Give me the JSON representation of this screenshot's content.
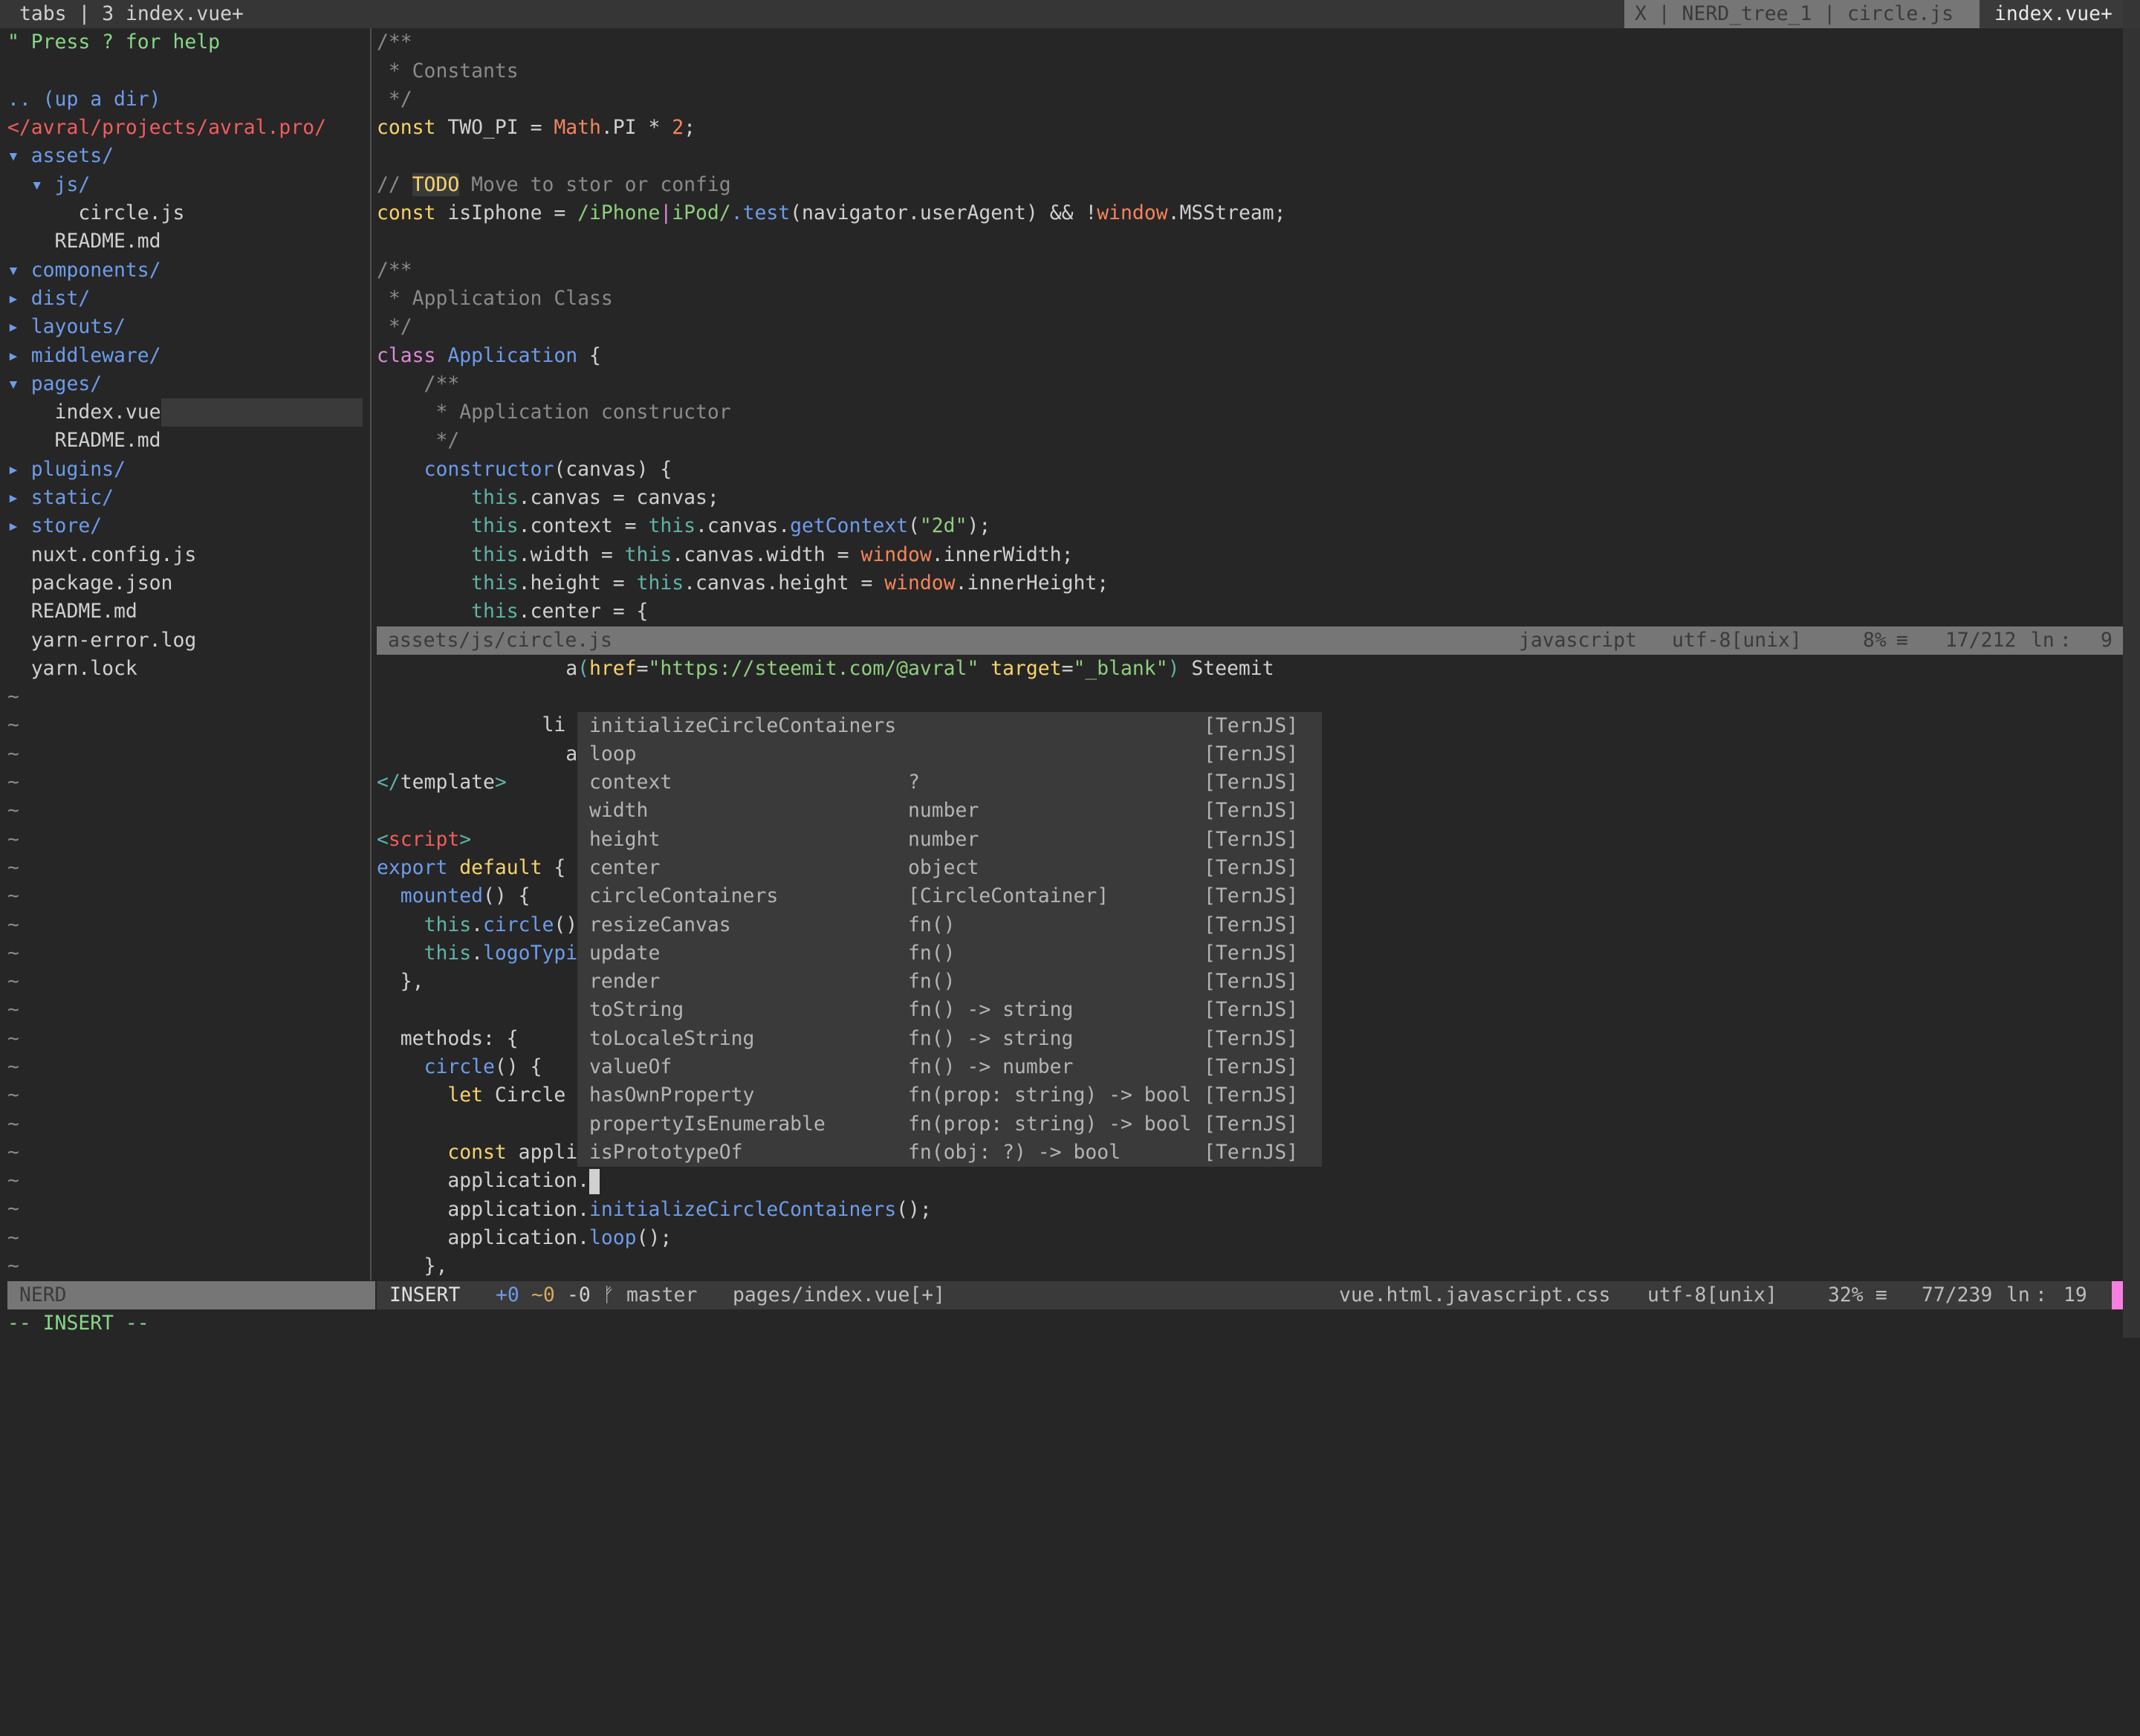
{
  "tabline": {
    "left": "tabs | 3 index.vue+",
    "inactive": "X | NERD_tree_1 | circle.js",
    "active": "index.vue+"
  },
  "nerdtree": {
    "lines": [
      [
        [
          "help",
          "\" Press ? for help"
        ]
      ],
      [],
      [
        [
          "d",
          ".. (up a dir)"
        ]
      ],
      [
        [
          "root",
          "</avral/projects/avral.pro/"
        ]
      ],
      [
        [
          "d",
          "▾ assets/"
        ]
      ],
      [
        [
          "d",
          "  ▾ js/"
        ]
      ],
      [
        [
          "f",
          "      circle.js"
        ]
      ],
      [
        [
          "f",
          "    README.md"
        ]
      ],
      [
        [
          "d",
          "▾ components/"
        ]
      ],
      [
        [
          "d",
          "▸ dist/"
        ]
      ],
      [
        [
          "d",
          "▸ layouts/"
        ]
      ],
      [
        [
          "d",
          "▸ middleware/"
        ]
      ],
      [
        [
          "d",
          "▾ pages/"
        ]
      ],
      [
        [
          "f",
          "    index.vue"
        ],
        [
          "cursorline",
          ""
        ]
      ],
      [
        [
          "f",
          "    README.md"
        ]
      ],
      [
        [
          "d",
          "▸ plugins/"
        ]
      ],
      [
        [
          "d",
          "▸ static/"
        ]
      ],
      [
        [
          "d",
          "▸ store/"
        ]
      ],
      [
        [
          "f",
          "  nuxt.config.js"
        ]
      ],
      [
        [
          "f",
          "  package.json"
        ]
      ],
      [
        [
          "f",
          "  README.md"
        ]
      ],
      [
        [
          "f",
          "  yarn-error.log"
        ]
      ],
      [
        [
          "f",
          "  yarn.lock"
        ]
      ]
    ],
    "empty_marker": "~",
    "status": "NERD"
  },
  "upper_window": {
    "lines": [
      [
        [
          "c",
          "/**"
        ]
      ],
      [
        [
          "c",
          " * Constants"
        ]
      ],
      [
        [
          "c",
          " */"
        ]
      ],
      [
        [
          "k",
          "const"
        ],
        [
          "",
          "TWO_PI = "
        ],
        [
          "o",
          "Math"
        ],
        [
          "",
          ".PI * "
        ],
        [
          "n",
          "2"
        ],
        [
          "",
          ";"
        ]
      ],
      [],
      [
        [
          "c",
          "// "
        ],
        [
          "todo",
          "TODO"
        ],
        [
          "c",
          " Move to stor or config"
        ]
      ],
      [
        [
          "k",
          "const"
        ],
        [
          "",
          "isIphone = "
        ],
        [
          "g",
          "/iPhone"
        ],
        [
          "p",
          "|"
        ],
        [
          "g",
          "iPod/"
        ],
        [
          "b",
          ".test"
        ],
        [
          "",
          "(navigator.userAgent) && !"
        ],
        [
          "o",
          "window"
        ],
        [
          "",
          ".MSStream;"
        ]
      ],
      [],
      [
        [
          "c",
          "/**"
        ]
      ],
      [
        [
          "c",
          " * Application Class"
        ]
      ],
      [
        [
          "c",
          " */"
        ]
      ],
      [
        [
          "p",
          "class"
        ],
        [
          "b",
          " Application"
        ],
        [
          "",
          " {"
        ]
      ],
      [
        [
          "c",
          "    /**"
        ]
      ],
      [
        [
          "c",
          "     * Application constructor"
        ]
      ],
      [
        [
          "c",
          "     */"
        ]
      ],
      [
        [
          "",
          "    "
        ],
        [
          "b",
          "constructor"
        ],
        [
          "",
          "(canvas) {"
        ]
      ],
      [
        [
          "",
          "        "
        ],
        [
          "t",
          "this"
        ],
        [
          "",
          ".canvas = canvas;"
        ]
      ],
      [
        [
          "",
          "        "
        ],
        [
          "t",
          "this"
        ],
        [
          "",
          ".context = "
        ],
        [
          "t",
          "this"
        ],
        [
          "",
          ".canvas."
        ],
        [
          "b",
          "getContext"
        ],
        [
          "",
          "("
        ],
        [
          "g",
          "\"2d\""
        ],
        [
          "",
          ");"
        ]
      ],
      [
        [
          "",
          "        "
        ],
        [
          "t",
          "this"
        ],
        [
          "",
          ".width = "
        ],
        [
          "t",
          "this"
        ],
        [
          "",
          ".canvas.width = "
        ],
        [
          "o",
          "window"
        ],
        [
          "",
          ".innerWidth;"
        ]
      ],
      [
        [
          "",
          "        "
        ],
        [
          "t",
          "this"
        ],
        [
          "",
          ".height = "
        ],
        [
          "t",
          "this"
        ],
        [
          "",
          ".canvas.height = "
        ],
        [
          "o",
          "window"
        ],
        [
          "",
          ".innerHeight;"
        ]
      ],
      [
        [
          "",
          "        "
        ],
        [
          "t",
          "this"
        ],
        [
          "",
          ".center = {"
        ]
      ]
    ],
    "status": {
      "file": "assets/js/circle.js",
      "filetype": "javascript",
      "encoding": "utf-8[unix]",
      "percent": "8%",
      "sep_icon": "≡",
      "position": "17/212",
      "ln": "ln",
      "colon": ":",
      "col": "9"
    }
  },
  "lower_window": {
    "lines": [
      [
        [
          "",
          "                a"
        ],
        [
          "t",
          "("
        ],
        [
          "k",
          "href"
        ],
        [
          "",
          "="
        ],
        [
          "g",
          "\"https://steemit.com/@avral\""
        ],
        [
          "",
          " "
        ],
        [
          "k",
          "target"
        ],
        [
          "",
          "="
        ],
        [
          "g",
          "\"_blank\""
        ],
        [
          "t",
          ")"
        ],
        [
          "",
          " Steemit"
        ]
      ],
      [],
      [
        [
          "",
          "              li"
        ]
      ],
      [
        [
          "",
          "                a"
        ]
      ],
      [
        [
          "t",
          "</"
        ],
        [
          "",
          "template"
        ],
        [
          "t",
          ">"
        ]
      ],
      [],
      [
        [
          "t",
          "<"
        ],
        [
          "r",
          "script"
        ],
        [
          "t",
          ">"
        ]
      ],
      [
        [
          "b",
          "export"
        ],
        [
          "",
          " "
        ],
        [
          "k",
          "default"
        ],
        [
          "",
          " {"
        ]
      ],
      [
        [
          "",
          "  "
        ],
        [
          "b",
          "mounted"
        ],
        [
          "",
          "() {"
        ]
      ],
      [
        [
          "",
          "    "
        ],
        [
          "t",
          "this"
        ],
        [
          "",
          "."
        ],
        [
          "b",
          "circle"
        ],
        [
          "",
          "()"
        ]
      ],
      [
        [
          "",
          "    "
        ],
        [
          "t",
          "this"
        ],
        [
          "",
          "."
        ],
        [
          "b",
          "logoTypi"
        ]
      ],
      [
        [
          "",
          "  },"
        ]
      ],
      [],
      [
        [
          "",
          "  methods: {"
        ]
      ],
      [
        [
          "",
          "    "
        ],
        [
          "b",
          "circle"
        ],
        [
          "",
          "() {"
        ]
      ],
      [
        [
          "",
          "      "
        ],
        [
          "k",
          "let"
        ],
        [
          "",
          " Circle"
        ]
      ],
      [],
      [
        [
          "",
          "      "
        ],
        [
          "k",
          "const"
        ],
        [
          "",
          " appli"
        ]
      ],
      [
        [
          "",
          "      application."
        ],
        [
          "cursor",
          ""
        ]
      ],
      [
        [
          "",
          "      application."
        ],
        [
          "b",
          "initializeCircleContainers"
        ],
        [
          "",
          "();"
        ]
      ],
      [
        [
          "",
          "      application."
        ],
        [
          "b",
          "loop"
        ],
        [
          "",
          "();"
        ]
      ],
      [
        [
          "",
          "    },"
        ]
      ]
    ],
    "status": {
      "mode": "INSERT",
      "git_added": "+0",
      "git_changed": "~0",
      "git_removed": "-0",
      "branch_icon": "ᚠ",
      "branch": "master",
      "file": "pages/index.vue[+]",
      "filetype": "vue.html.javascript.css",
      "encoding": "utf-8[unix]",
      "percent": "32%",
      "sep_icon": "≡",
      "position": "77/239",
      "ln": "ln",
      "colon": ":",
      "col": "19"
    }
  },
  "completion_popup": {
    "items": [
      {
        "name": "initializeCircleContainers",
        "type": "",
        "kind": "[TernJS]"
      },
      {
        "name": "loop",
        "type": "",
        "kind": "[TernJS]"
      },
      {
        "name": "context",
        "type": "?",
        "kind": "[TernJS]"
      },
      {
        "name": "width",
        "type": "number",
        "kind": "[TernJS]"
      },
      {
        "name": "height",
        "type": "number",
        "kind": "[TernJS]"
      },
      {
        "name": "center",
        "type": "object",
        "kind": "[TernJS]"
      },
      {
        "name": "circleContainers",
        "type": "[CircleContainer]",
        "kind": "[TernJS]"
      },
      {
        "name": "resizeCanvas",
        "type": "fn()",
        "kind": "[TernJS]"
      },
      {
        "name": "update",
        "type": "fn()",
        "kind": "[TernJS]"
      },
      {
        "name": "render",
        "type": "fn()",
        "kind": "[TernJS]"
      },
      {
        "name": "toString",
        "type": "fn() -> string",
        "kind": "[TernJS]"
      },
      {
        "name": "toLocaleString",
        "type": "fn() -> string",
        "kind": "[TernJS]"
      },
      {
        "name": "valueOf",
        "type": "fn() -> number",
        "kind": "[TernJS]"
      },
      {
        "name": "hasOwnProperty",
        "type": "fn(prop: string) -> bool",
        "kind": "[TernJS]"
      },
      {
        "name": "propertyIsEnumerable",
        "type": "fn(prop: string) -> bool",
        "kind": "[TernJS]"
      },
      {
        "name": "isPrototypeOf",
        "type": "fn(obj: ?) -> bool",
        "kind": "[TernJS]"
      }
    ]
  },
  "cmdline": "-- INSERT --",
  "colors": {
    "background": "#262626",
    "comment": "#8a8a8a",
    "keyword": "#f7d36b",
    "builtin": "#f5845c",
    "string": "#8fce7f",
    "function": "#6d9cea",
    "this": "#5fb3a7",
    "mode_accent": "#f77fe0"
  }
}
